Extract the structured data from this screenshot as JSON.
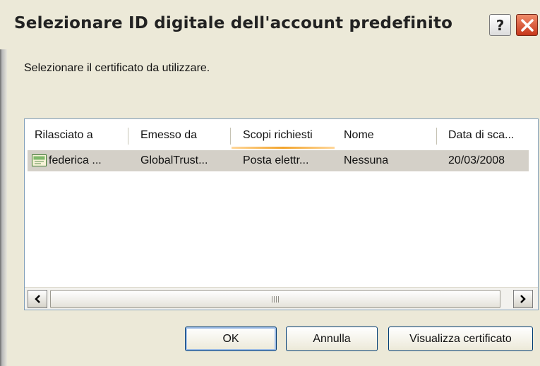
{
  "window": {
    "title": "Selezionare ID digitale dell'account predefinito",
    "help_label": "?"
  },
  "prompt": "Selezionare il certificato da utilizzare.",
  "list": {
    "columns": [
      "Rilasciato a",
      "Emesso da",
      "Scopi richiesti",
      "Nome",
      "Data di sca..."
    ],
    "rows": [
      {
        "icon": "certificate-icon",
        "cells": [
          "federica ...",
          "GlobalTrust...",
          "Posta elettr...",
          "Nessuna",
          "20/03/2008"
        ],
        "selected": true
      }
    ]
  },
  "buttons": {
    "ok": "OK",
    "cancel": "Annulla",
    "view_cert": "Visualizza certificato"
  },
  "colors": {
    "dialog_bg": "#ECE9D8",
    "close_red": "#C6371B",
    "selection": "#D4D0C8",
    "sort_accent": "#F2A42C"
  }
}
